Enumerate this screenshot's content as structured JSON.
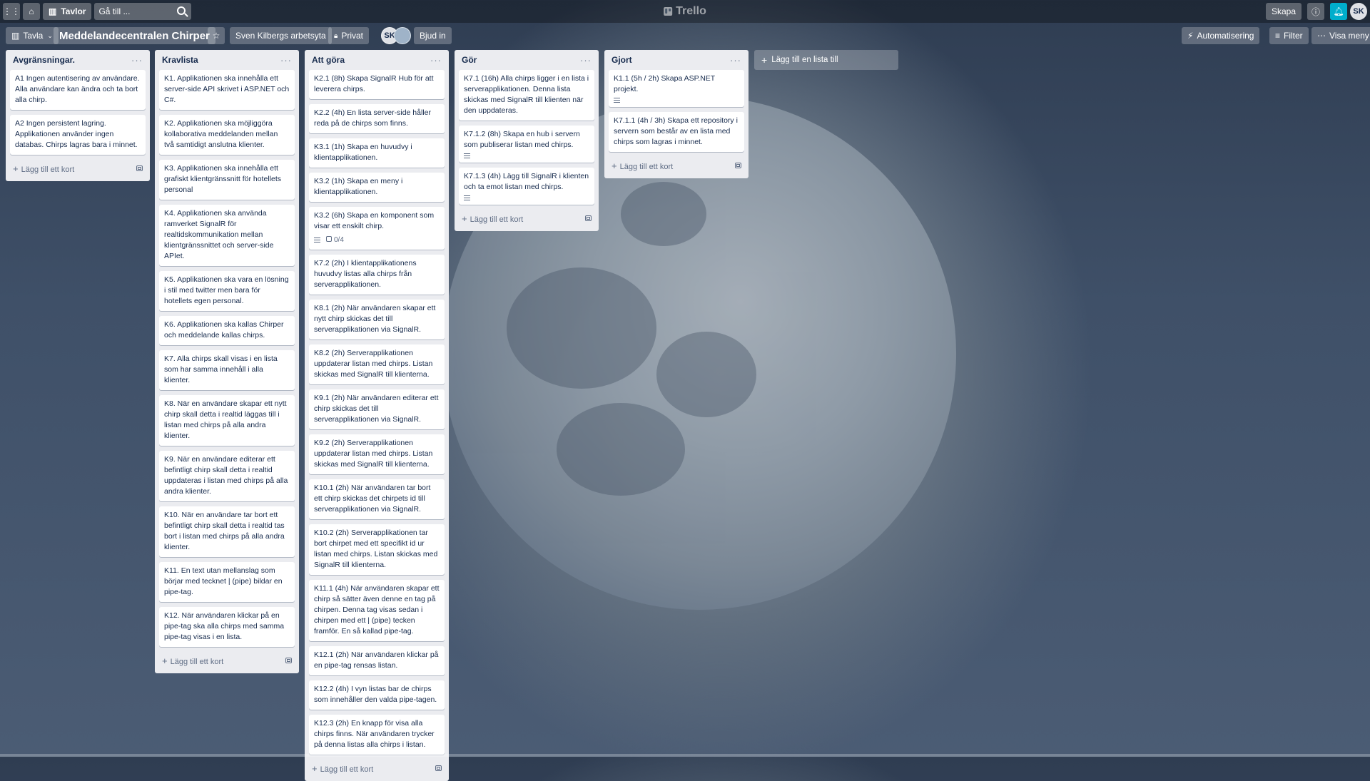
{
  "topbar": {
    "boards_label": "Tavlor",
    "search_value": "Gå till ...",
    "logo_text": "Trello",
    "create_label": "Skapa",
    "user_initials": "SK"
  },
  "board": {
    "view_label": "Tavla",
    "title": "Meddelandecentralen Chirper",
    "workspace": "Sven Kilbergs arbetsyta",
    "visibility": "Privat",
    "member_initials": "SK",
    "invite_label": "Bjud in",
    "automation_label": "Automatisering",
    "filter_label": "Filter",
    "menu_label": "Visa meny"
  },
  "add_card_label": "Lägg till ett kort",
  "add_list_label": "Lägg till en lista till",
  "lists": [
    {
      "title": "Avgränsningar.",
      "cards": [
        {
          "text": "A1 Ingen autentisering av användare. Alla användare kan ändra och ta bort alla chirp."
        },
        {
          "text": "A2 Ingen persistent lagring. Applikationen använder ingen databas. Chirps lagras bara i minnet."
        }
      ]
    },
    {
      "title": "Kravlista",
      "cards": [
        {
          "text": "K1. Applikationen ska innehålla ett server-side API skrivet i ASP.NET och C#."
        },
        {
          "text": "K2. Applikationen ska möjliggöra kollaborativa meddelanden mellan två samtidigt anslutna klienter."
        },
        {
          "text": "K3. Applikationen ska innehålla ett grafiskt klientgränssnitt för hotellets personal"
        },
        {
          "text": "K4. Applikationen ska använda ramverket SignalR för realtidskommunikation mellan klientgränssnittet och server-side APIet."
        },
        {
          "text": "K5. Applikationen ska vara en lösning i stil med twitter men bara för hotellets egen personal."
        },
        {
          "text": "K6. Applikationen ska kallas Chirper och meddelande kallas chirps."
        },
        {
          "text": "K7. Alla chirps skall visas i en lista som har samma innehåll i alla klienter."
        },
        {
          "text": "K8. När en användare skapar ett nytt chirp skall detta i realtid läggas till i listan med chirps på alla andra klienter."
        },
        {
          "text": "K9. När en användare editerar ett befintligt chirp skall detta i realtid uppdateras i listan med chirps på alla andra klienter."
        },
        {
          "text": "K10. När en användare tar bort ett befintligt chirp skall detta i realtid tas bort i listan med chirps på alla andra klienter."
        },
        {
          "text": "K11. En text utan mellanslag som börjar med tecknet | (pipe) bildar en pipe-tag."
        },
        {
          "text": "K12. När användaren klickar på en pipe-tag ska alla chirps med samma pipe-tag visas i en lista."
        }
      ]
    },
    {
      "title": "Att göra",
      "cards": [
        {
          "text": "K2.1 (8h) Skapa SignalR Hub för att leverera chirps."
        },
        {
          "text": "K2.2 (4h) En lista server-side håller reda på de chirps som finns."
        },
        {
          "text": "K3.1 (1h) Skapa en huvudvy i klientapplikationen."
        },
        {
          "text": "K3.2 (1h) Skapa en meny i klientapplikationen."
        },
        {
          "text": "K3.2 (6h) Skapa en komponent som visar ett enskilt chirp.",
          "desc": true,
          "checklist": "0/4"
        },
        {
          "text": "K7.2 (2h) I klientapplikationens huvudvy listas alla chirps från serverapplikationen."
        },
        {
          "text": "K8.1 (2h) När användaren skapar ett nytt chirp skickas det till serverapplikationen via SignalR."
        },
        {
          "text": "K8.2 (2h) Serverapplikationen uppdaterar listan med chirps. Listan skickas med SignalR till klienterna."
        },
        {
          "text": "K9.1 (2h) När användaren editerar ett chirp skickas det till serverapplikationen via SignalR."
        },
        {
          "text": "K9.2 (2h) Serverapplikationen uppdaterar listan med chirps. Listan skickas med SignalR till klienterna."
        },
        {
          "text": "K10.1 (2h) När användaren tar bort ett chirp skickas det chirpets id till serverapplikationen via SignalR."
        },
        {
          "text": "K10.2 (2h) Serverapplikationen tar bort chirpet med ett specifikt id ur listan med chirps. Listan skickas med SignalR till klienterna."
        },
        {
          "text": "K11.1 (4h) När användaren skapar ett chirp så sätter även denne en tag på chirpen. Denna tag visas sedan i chirpen med ett | (pipe) tecken framför. En så kallad pipe-tag."
        },
        {
          "text": "K12.1 (2h) När användaren klickar på en pipe-tag rensas listan."
        },
        {
          "text": "K12.2 (4h) I vyn listas bar de chirps som innehåller den valda pipe-tagen."
        },
        {
          "text": "K12.3 (2h) En knapp för visa alla chirps finns. När användaren trycker på denna listas alla chirps i listan."
        }
      ]
    },
    {
      "title": "Gör",
      "cards": [
        {
          "text": "K7.1 (16h) Alla chirps ligger i en lista i serverapplikationen. Denna lista skickas med SignalR till klienten när den uppdateras."
        },
        {
          "text": "K7.1.2 (8h) Skapa en hub i servern som publiserar listan med chirps.",
          "desc": true
        },
        {
          "text": "K7.1.3 (4h) Lägg till SignalR i klienten och ta emot listan med chirps.",
          "desc": true
        }
      ]
    },
    {
      "title": "Gjort",
      "cards": [
        {
          "text": "K1.1 (5h / 2h) Skapa ASP.NET projekt.",
          "desc": true
        },
        {
          "text": "K7.1.1 (4h / 3h) Skapa ett repository i servern som består av en lista med chirps som lagras i minnet."
        }
      ]
    }
  ]
}
